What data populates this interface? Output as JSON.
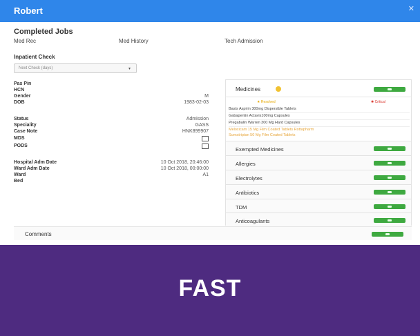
{
  "header": {
    "title": "Robert",
    "close_icon": "close-icon",
    "color": "#2f86ea"
  },
  "jobs": {
    "title": "Completed Jobs",
    "items": [
      {
        "label": "Med Rec",
        "checked": true
      },
      {
        "label": "Med History",
        "checked": true
      },
      {
        "label": "Tech Admission",
        "checked": false
      }
    ]
  },
  "inpatient": {
    "title": "Inpatient Check",
    "select_value": "Next Check (days)"
  },
  "patient": [
    {
      "key": "Pas Pin",
      "value": ""
    },
    {
      "key": "HCN",
      "value": ""
    },
    {
      "key": "Gender",
      "value": "M"
    },
    {
      "key": "DOB",
      "value": "1983-02-03"
    }
  ],
  "status": [
    {
      "key": "Status",
      "value": "Admission"
    },
    {
      "key": "Speciality",
      "value": "GASS"
    },
    {
      "key": "Case Note",
      "value": "HNK899907"
    },
    {
      "key": "MDS",
      "value": "",
      "checkbox": true
    },
    {
      "key": "PODS",
      "value": "",
      "checkbox": true
    }
  ],
  "admission": [
    {
      "key": "Hospital Adm Date",
      "value": "10 Oct 2018, 20:46:00"
    },
    {
      "key": "Ward Adm Date",
      "value": "10 Oct 2018, 00:00:00"
    },
    {
      "key": "Ward",
      "value": "A1"
    },
    {
      "key": "Bed",
      "value": ""
    }
  ],
  "medicines": {
    "title": "Medicines",
    "legend_green": "★ Resolved",
    "legend_red": "✱ Critical",
    "drugs": [
      "Basts Aspirin 300mg Dispersible Tablets",
      "Gabapentin Actavis100mg Capsules",
      "Pregabalin Warren 300 Mg Hard Capsules"
    ],
    "warnings": [
      "Meloxicam 15 Mg Film Coated Tablets Rottapharm",
      "Sumatriptan 50 Mg Film Coated Tablets"
    ]
  },
  "sections": [
    "Exempted Medicines",
    "Allergies",
    "Electrolytes",
    "Antibiotics",
    "TDM",
    "Anticoagulants"
  ],
  "comments": {
    "title": "Comments"
  },
  "banner": {
    "text": "FAST",
    "color": "#4e2b80"
  },
  "accent": {
    "green": "#3ea940",
    "warning": "#f1c232",
    "critical": "#d9342b"
  }
}
